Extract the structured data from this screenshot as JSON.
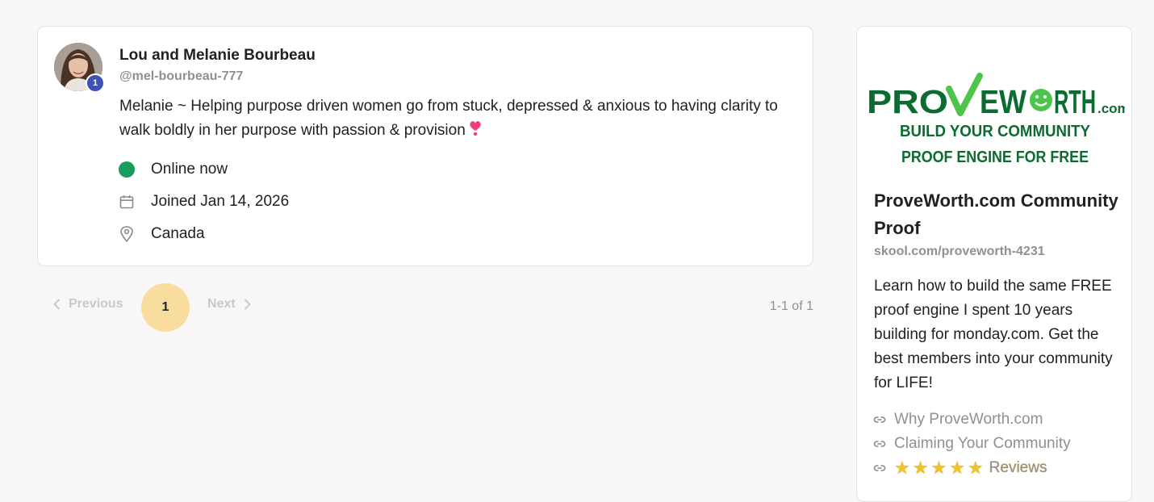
{
  "member": {
    "name": "Lou and Melanie Bourbeau",
    "handle": "@mel-bourbeau-777",
    "level": "1",
    "bio": "Melanie ~ Helping purpose driven women go from stuck, depressed & anxious to having clarity to walk boldly in her purpose with passion & provision",
    "status": "Online now",
    "joined": "Joined Jan 14, 2026",
    "location": "Canada"
  },
  "pagination": {
    "previous_label": "Previous",
    "current_page": "1",
    "next_label": "Next",
    "count": "1-1 of 1"
  },
  "sidebar": {
    "logo": {
      "brand_pre": "PRO",
      "brand_post": "EW",
      "brand_end": "RTH",
      "brand_suffix": ".com",
      "tagline_1": "BUILD YOUR COMMUNITY",
      "tagline_2": "PROOF ENGINE FOR FREE"
    },
    "title": "ProveWorth.com Community Proof",
    "url": "skool.com/proveworth-4231",
    "description": "Learn how to build the same FREE proof engine I spent 10 years building for monday.com. Get the best members into your community for LIFE!",
    "links": [
      {
        "label": "Why ProveWorth.com"
      },
      {
        "label": "Claiming Your Community"
      },
      {
        "label": "Reviews",
        "stars": [
          "★",
          "★",
          "★",
          "★",
          "★"
        ]
      }
    ]
  },
  "colors": {
    "online": "#1a9c5b",
    "level_badge": "#3f51b5",
    "current_page": "#f8dd9f",
    "brand_green": "#0b6b30",
    "star": "#f2c12e"
  }
}
